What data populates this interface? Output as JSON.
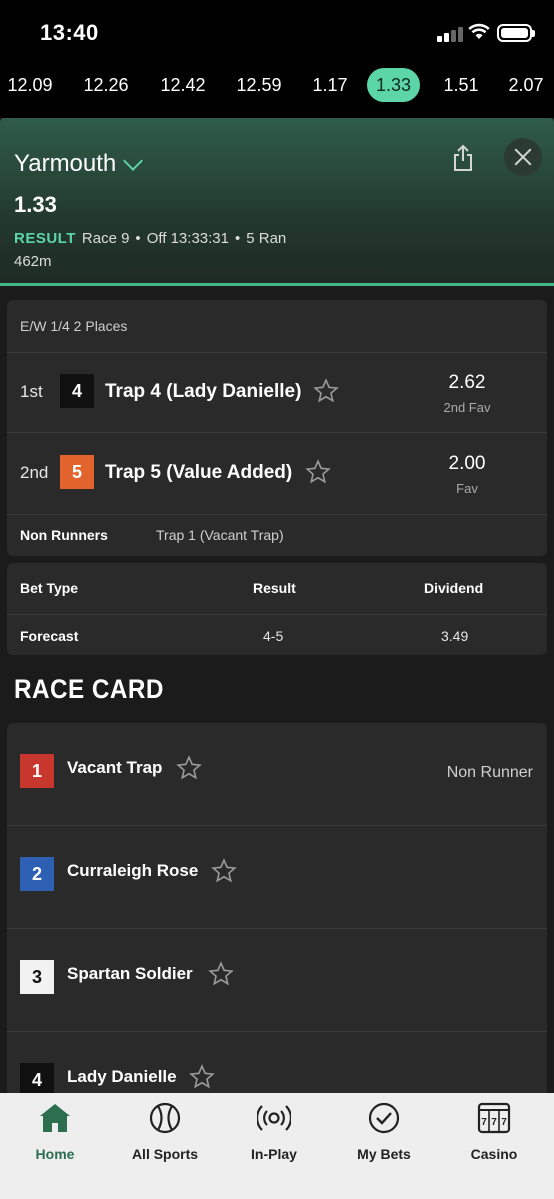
{
  "status_bar": {
    "time": "13:40"
  },
  "race_times": [
    {
      "label": "12.09",
      "active": false
    },
    {
      "label": "12.26",
      "active": false
    },
    {
      "label": "12.42",
      "active": false
    },
    {
      "label": "12.59",
      "active": false
    },
    {
      "label": "1.17",
      "active": false
    },
    {
      "label": "1.33",
      "active": true
    },
    {
      "label": "1.51",
      "active": false
    },
    {
      "label": "2.07",
      "active": false
    }
  ],
  "header": {
    "venue": "Yarmouth",
    "race_time": "1.33",
    "result_label": "RESULT",
    "race_number": "Race 9",
    "off_time": "Off 13:33:31",
    "runners": "5 Ran",
    "distance": "462m"
  },
  "result": {
    "ew_terms": "E/W 1/4 2 Places",
    "places": [
      {
        "position": "1st",
        "trap": "4",
        "name": "Trap 4 (Lady Danielle)",
        "odds": "2.62",
        "fav": "2nd Fav"
      },
      {
        "position": "2nd",
        "trap": "5",
        "name": "Trap 5 (Value Added)",
        "odds": "2.00",
        "fav": "Fav"
      }
    ],
    "non_runners_label": "Non Runners",
    "non_runners_value": "Trap 1 (Vacant Trap)"
  },
  "bet_table": {
    "headers": [
      "Bet Type",
      "Result",
      "Dividend"
    ],
    "rows": [
      [
        "Forecast",
        "4-5",
        "3.49"
      ]
    ]
  },
  "race_card": {
    "title": "RACE CARD",
    "runners": [
      {
        "trap": "1",
        "name": "Vacant Trap",
        "status": "Non Runner"
      },
      {
        "trap": "2",
        "name": "Curraleigh Rose",
        "status": ""
      },
      {
        "trap": "3",
        "name": "Spartan Soldier",
        "status": ""
      },
      {
        "trap": "4",
        "name": "Lady Danielle",
        "status": ""
      }
    ]
  },
  "trap_colors": {
    "1": {
      "bg": "#c8372d",
      "fg": "#ffffff"
    },
    "2": {
      "bg": "#2d5fb3",
      "fg": "#ffffff"
    },
    "3": {
      "bg": "#f2f2f2",
      "fg": "#111111"
    },
    "4": {
      "bg": "#111111",
      "fg": "#ffffff"
    },
    "5": {
      "bg": "#e2642c",
      "fg": "#ffffff"
    }
  },
  "bottom_nav": [
    {
      "label": "Home",
      "icon": "home-icon",
      "active": true
    },
    {
      "label": "All Sports",
      "icon": "ball-icon",
      "active": false
    },
    {
      "label": "In-Play",
      "icon": "broadcast-icon",
      "active": false
    },
    {
      "label": "My Bets",
      "icon": "check-circle-icon",
      "active": false
    },
    {
      "label": "Casino",
      "icon": "slot-machine-icon",
      "active": false
    }
  ]
}
